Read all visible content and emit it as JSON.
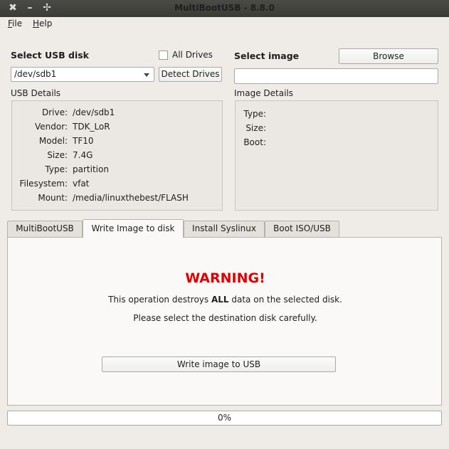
{
  "window": {
    "title": "MultiBootUSB - 8.8.0",
    "close_glyph": "✖",
    "minimize_glyph": "–",
    "maximize_glyph": "✢"
  },
  "menu": {
    "file": {
      "first": "F",
      "rest": "ile"
    },
    "help": {
      "first": "H",
      "rest": "elp"
    }
  },
  "usb": {
    "select_label": "Select USB disk",
    "all_drives_label": "All Drives",
    "all_drives_checked": false,
    "selected_disk": "/dev/sdb1",
    "detect_button": "Detect Drives",
    "details_title": "USB Details",
    "details": {
      "drive_key": "Drive:",
      "drive": "/dev/sdb1",
      "vendor_key": "Vendor:",
      "vendor": "TDK_LoR",
      "model_key": "Model:",
      "model": "TF10",
      "size_key": "Size:",
      "size": "7.4G",
      "type_key": "Type:",
      "type": "partition",
      "filesystem_key": "Filesystem:",
      "filesystem": "vfat",
      "mount_key": "Mount:",
      "mount": "/media/linuxthebest/FLASH"
    }
  },
  "image": {
    "select_label": "Select image",
    "browse_button": "Browse",
    "path_value": "",
    "details_title": "Image Details",
    "type_key": "Type:",
    "size_key": "Size:",
    "boot_key": "Boot:"
  },
  "tabs": [
    "MultiBootUSB",
    "Write Image to disk",
    "Install Syslinux",
    "Boot ISO/USB"
  ],
  "active_tab": "Write Image to disk",
  "write_panel": {
    "warning": "WARNING!",
    "line1_pre": "This operation destroys ",
    "line1_bold": "ALL",
    "line1_post": " data on the selected disk.",
    "line2": "Please select the destination disk carefully.",
    "write_button": "Write image to USB"
  },
  "progress": {
    "value": 0,
    "label": "0%"
  },
  "colors": {
    "warning": "#e00000",
    "window_bg": "#efebe7"
  }
}
